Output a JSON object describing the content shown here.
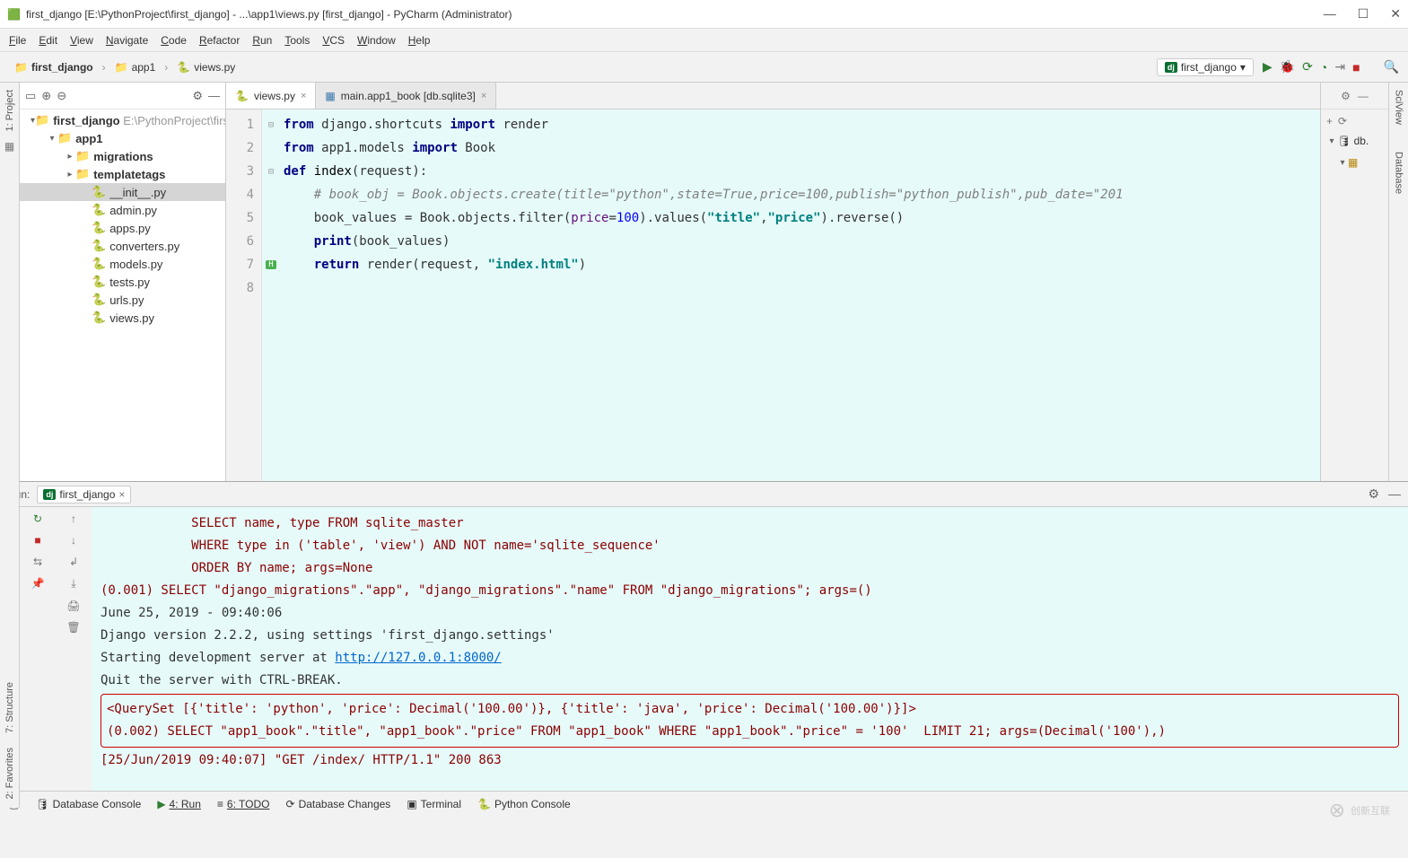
{
  "window_title": "first_django [E:\\PythonProject\\first_django] - ...\\app1\\views.py [first_django] - PyCharm (Administrator)",
  "menubar": [
    "File",
    "Edit",
    "View",
    "Navigate",
    "Code",
    "Refactor",
    "Run",
    "Tools",
    "VCS",
    "Window",
    "Help"
  ],
  "breadcrumb": [
    "first_django",
    "app1",
    "views.py"
  ],
  "run_config": "first_django",
  "project_tree": {
    "root": {
      "name": "first_django",
      "path": "E:\\PythonProject\\first_django"
    },
    "app1": "app1",
    "migrations": "migrations",
    "templatetags": "templatetags",
    "files": [
      "__init__.py",
      "admin.py",
      "apps.py",
      "converters.py",
      "models.py",
      "tests.py",
      "urls.py",
      "views.py"
    ]
  },
  "editor_tabs": [
    {
      "label": "views.py",
      "active": true
    },
    {
      "label": "main.app1_book [db.sqlite3]",
      "active": false
    }
  ],
  "code_lines": [
    {
      "n": 1,
      "html": "<span class='kw'>from</span> django.shortcuts <span class='kw'>import</span> render"
    },
    {
      "n": 2,
      "html": "<span class='kw'>from</span> app1.models <span class='kw'>import</span> Book"
    },
    {
      "n": 3,
      "html": "<span class='kw'>def</span> <span class='fn'>index</span>(request):"
    },
    {
      "n": 4,
      "html": "    <span class='cm'># book_obj = Book.objects.create(title=\"python\",state=True,price=100,publish=\"python_publish\",pub_date=\"201</span>"
    },
    {
      "n": 5,
      "html": "    book_values = Book.objects.filter(<span class='py-id'>price</span>=<span class='nm'>100</span>).values(<span class='st'>\"title\"</span>,<span class='st'>\"price\"</span>).reverse()"
    },
    {
      "n": 6,
      "html": "    <span class='kw'>print</span>(book_values)"
    },
    {
      "n": 7,
      "html": "    <span class='kw'>return</span> render(request, <span class='st'>\"index.html\"</span>)"
    },
    {
      "n": 8,
      "html": ""
    }
  ],
  "run_tab": "first_django",
  "run_label": "Run:",
  "console_lines": [
    {
      "cls": "sql",
      "text": "            SELECT name, type FROM sqlite_master"
    },
    {
      "cls": "sql",
      "text": "            WHERE type in ('table', 'view') AND NOT name='sqlite_sequence'"
    },
    {
      "cls": "sql",
      "text": "            ORDER BY name; args=None"
    },
    {
      "cls": "sql",
      "text": "(0.001) SELECT \"django_migrations\".\"app\", \"django_migrations\".\"name\" FROM \"django_migrations\"; args=()"
    },
    {
      "cls": "",
      "text": "June 25, 2019 - 09:40:06"
    },
    {
      "cls": "",
      "text": "Django version 2.2.2, using settings 'first_django.settings'"
    },
    {
      "cls": "link-line",
      "text": "Starting development server at ",
      "link": "http://127.0.0.1:8000/"
    },
    {
      "cls": "",
      "text": "Quit the server with CTRL-BREAK."
    },
    {
      "cls": "boxed",
      "lines": [
        "<QuerySet [{'title': 'python', 'price': Decimal('100.00')}, {'title': 'java', 'price': Decimal('100.00')}]>",
        "(0.002) SELECT \"app1_book\".\"title\", \"app1_book\".\"price\" FROM \"app1_book\" WHERE \"app1_book\".\"price\" = '100'  LIMIT 21; args=(Decimal('100'),)"
      ]
    },
    {
      "cls": "sql",
      "text": "[25/Jun/2019 09:40:07] \"GET /index/ HTTP/1.1\" 200 863"
    }
  ],
  "statusbar": [
    "Database Console",
    "4: Run",
    "6: TODO",
    "Database Changes",
    "Terminal",
    "Python Console"
  ],
  "right_tree": [
    "db."
  ],
  "left_rail": "1: Project",
  "left_lower": [
    "7: Structure",
    "2: Favorites"
  ],
  "right_rail": [
    "SciView",
    "Database"
  ]
}
